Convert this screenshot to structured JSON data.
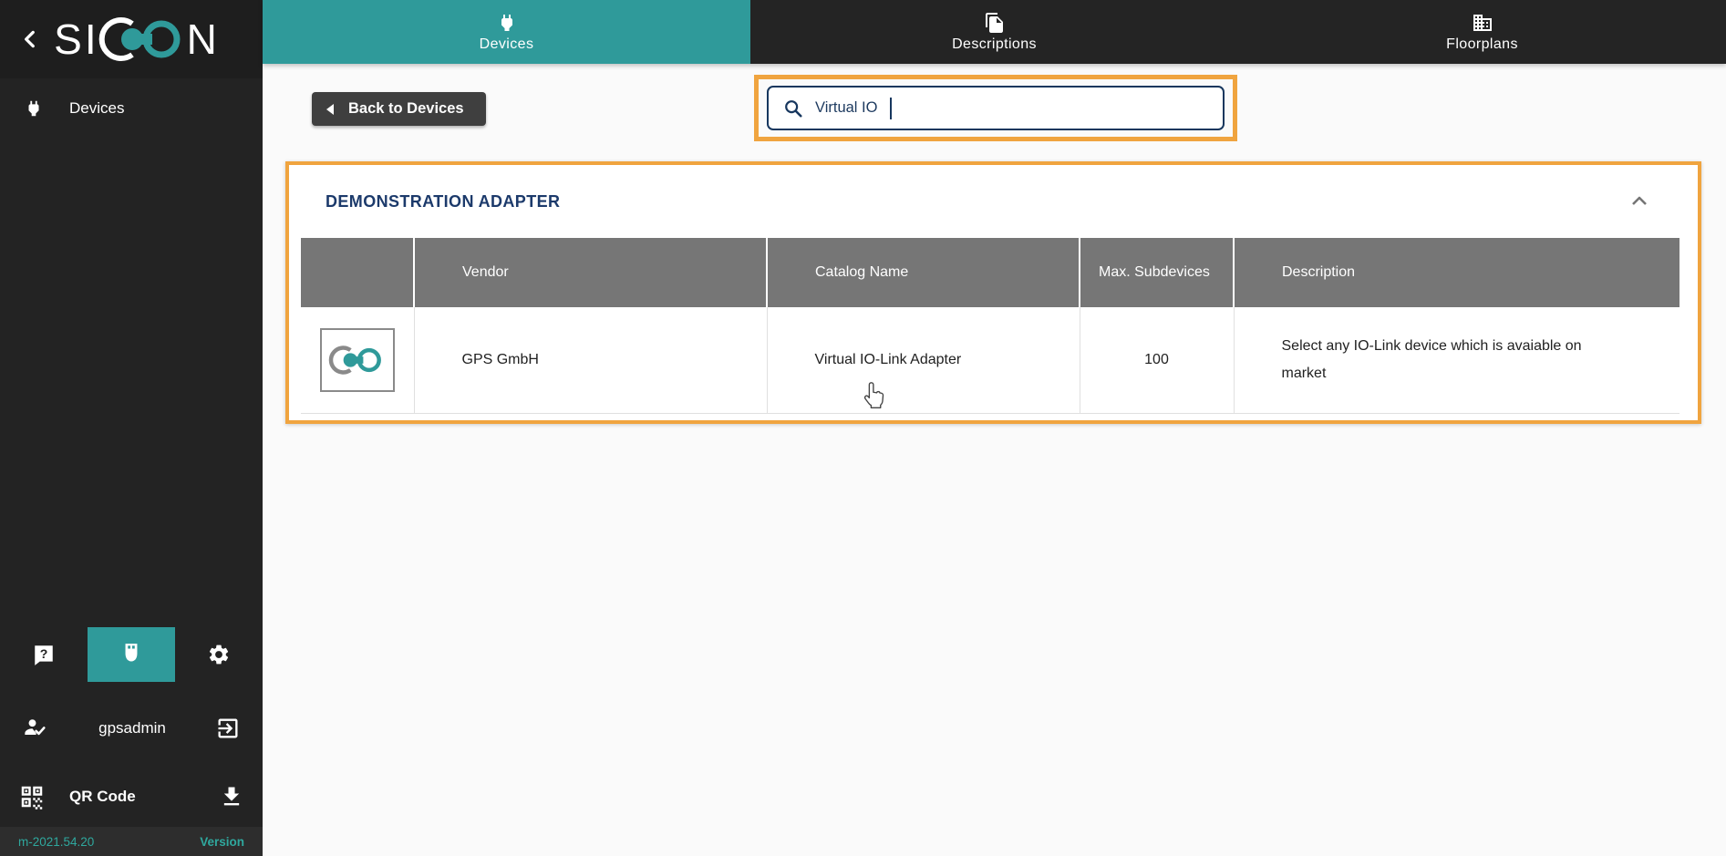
{
  "brand": {
    "prefix": "SI",
    "suffix": "N",
    "full_name": "SICON"
  },
  "sidebar": {
    "items": [
      {
        "label": "Devices"
      }
    ],
    "user_name": "gpsadmin",
    "qr_label": "QR Code",
    "version_value": "m-2021.54.20",
    "version_label": "Version"
  },
  "tabs": [
    {
      "label": "Devices",
      "active": true
    },
    {
      "label": "Descriptions",
      "active": false
    },
    {
      "label": "Floorplans",
      "active": false
    }
  ],
  "toolbar": {
    "back_label": "Back to Devices"
  },
  "search": {
    "value": "Virtual IO"
  },
  "card": {
    "title": "DEMONSTRATION ADAPTER",
    "table": {
      "headers": [
        "",
        "Vendor",
        "Catalog Name",
        "Max. Subdevices",
        "Description"
      ],
      "rows": [
        {
          "vendor": "GPS GmbH",
          "catalog_name": "Virtual IO-Link Adapter",
          "max_subdevices": "100",
          "description": "Select any IO-Link device which is avaiable on market"
        }
      ]
    }
  },
  "colors": {
    "accent_teal": "#2f9a9a",
    "annotation_orange": "#f0a43f",
    "navy": "#17375e",
    "table_header_gray": "#767676",
    "sidebar_dark": "#232323"
  }
}
